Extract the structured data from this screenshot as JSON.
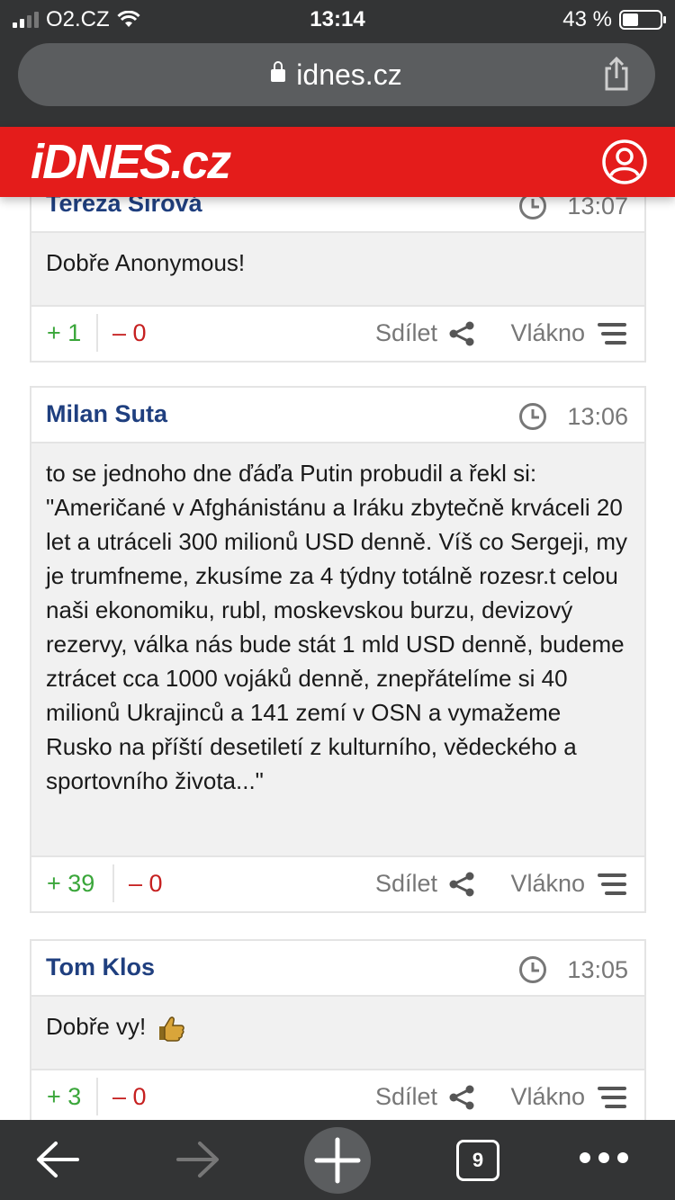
{
  "status_bar": {
    "carrier": "O2.CZ",
    "time": "13:14",
    "battery_text": "43 %",
    "battery_level": 0.43
  },
  "url_bar": {
    "domain": "idnes.cz"
  },
  "header": {
    "logo": "iDNES.cz"
  },
  "comments": [
    {
      "author": "Tereza Sirová",
      "time": "13:07",
      "text": "Dobře Anonymous!",
      "plus": "+ 1",
      "minus": "– 0",
      "share_label": "Sdílet",
      "thread_label": "Vlákno"
    },
    {
      "author": "Milan Suta",
      "time": "13:06",
      "text": "to se jednoho dne ďáďa Putin probudil a řekl si: \"Američané v Afghánistánu a Iráku zbytečně krváceli 20 let a utráceli 300 milionů USD denně. Víš co Sergeji, my je trumfneme, zkusíme za 4 týdny totálně rozesr.t celou naši ekonomiku, rubl, moskevskou burzu, devizový rezervy, válka nás bude stát 1 mld USD denně, budeme ztrácet cca 1000 vojáků denně, znepřátelíme si 40 milionů Ukrajinců a 141 zemí v OSN a vymažeme Rusko na příští desetiletí z kulturního, vědeckého a sportovního života...\"",
      "plus": "+ 39",
      "minus": "– 0",
      "share_label": "Sdílet",
      "thread_label": "Vlákno"
    },
    {
      "author": "Tom Klos",
      "time": "13:05",
      "text": "Dobře vy!",
      "plus": "+ 3",
      "minus": "– 0",
      "share_label": "Sdílet",
      "thread_label": "Vlákno"
    }
  ],
  "bottom_bar": {
    "tabs_count": "9"
  },
  "colors": {
    "brand_red": "#e41c1b",
    "author_blue": "#1f3f7f",
    "plus_green": "#3aa63a",
    "minus_red": "#c62020"
  }
}
